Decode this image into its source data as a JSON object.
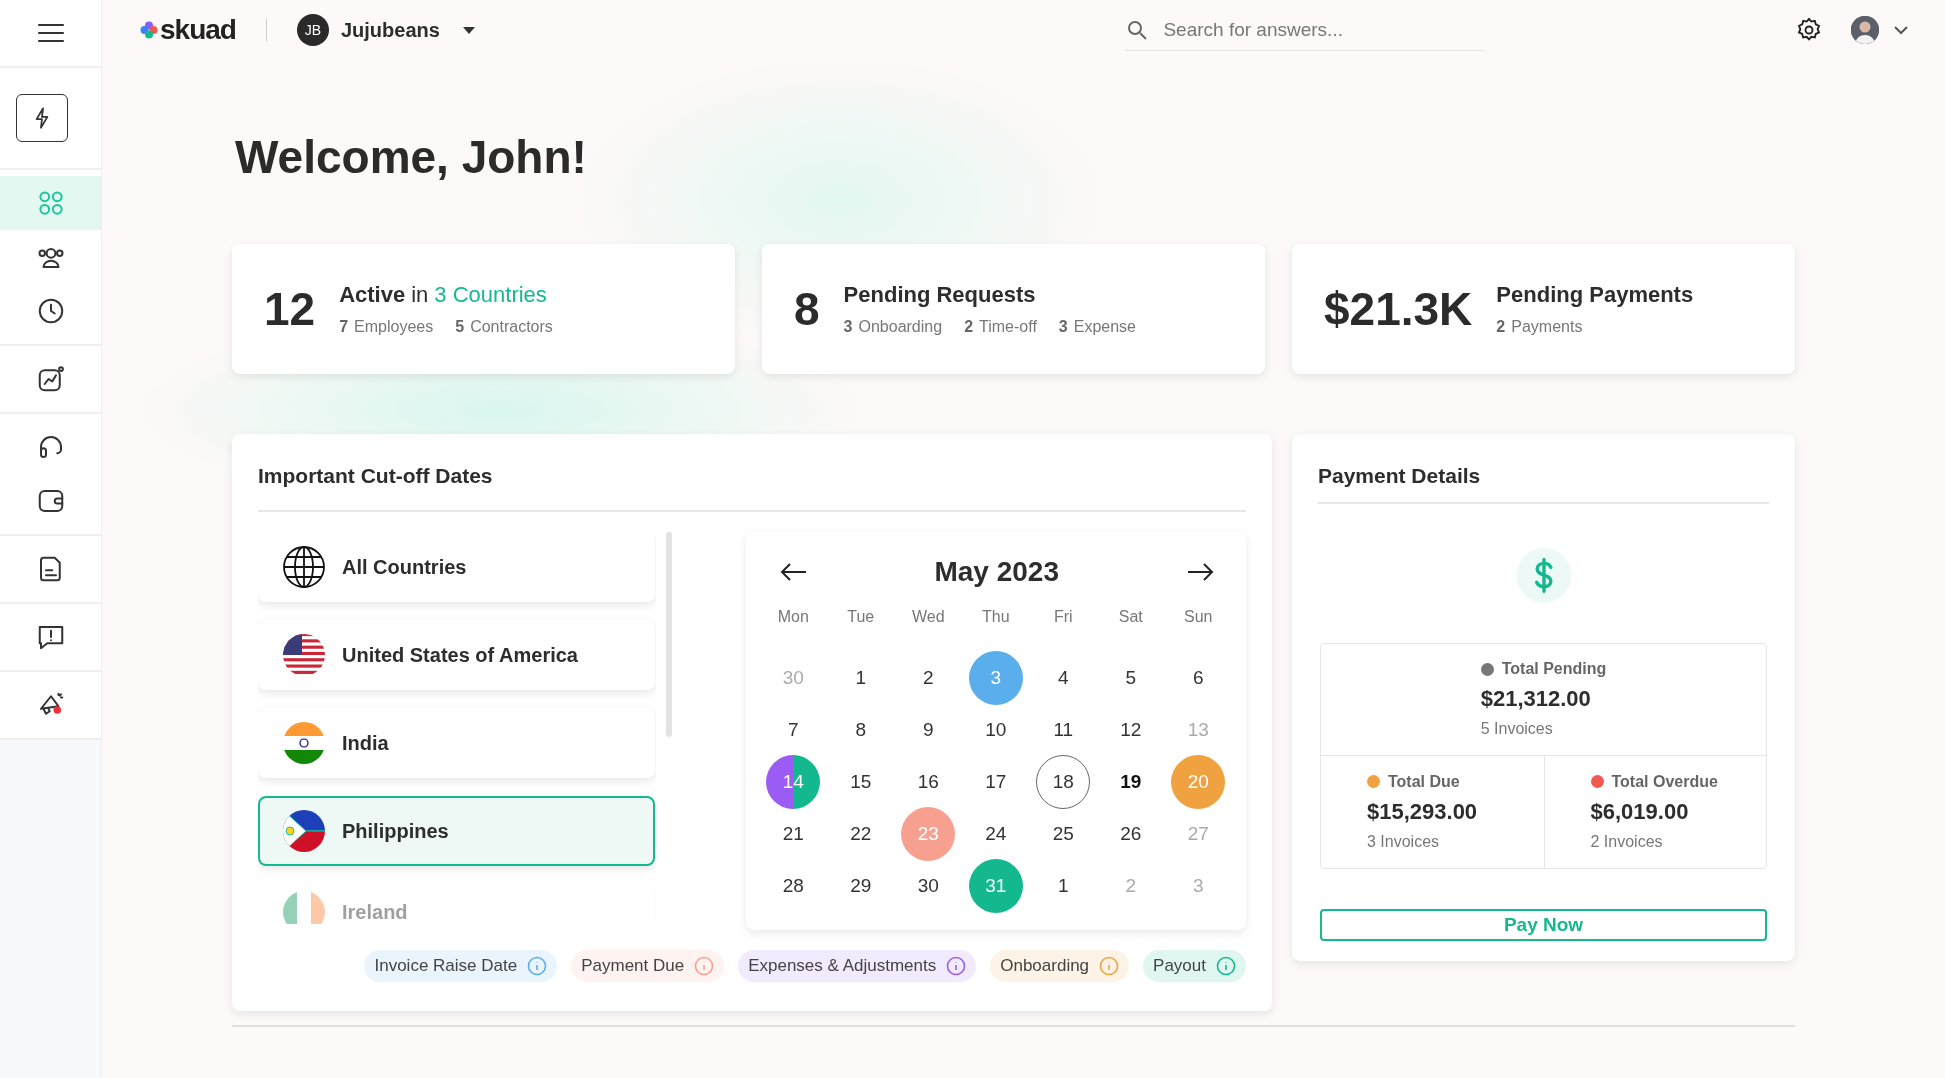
{
  "sidebar": {
    "groups": [
      [
        {
          "selected": false
        }
      ],
      [
        {
          "selected": false
        }
      ],
      [
        {
          "selected": true
        },
        {
          "selected": false
        },
        {
          "selected": false
        }
      ],
      [
        {
          "selected": false
        }
      ],
      [
        {
          "selected": false
        },
        {
          "selected": false
        }
      ],
      [
        {
          "selected": false
        }
      ],
      [
        {
          "selected": false
        }
      ],
      [
        {
          "selected": false
        }
      ]
    ]
  },
  "header": {
    "logo": "skuad",
    "company": {
      "initials": "JB",
      "name": "Jujubeans"
    },
    "search": {
      "placeholder": "Search for answers..."
    }
  },
  "welcome": "Welcome, John!",
  "stats": [
    {
      "value": "12",
      "title": "Active",
      "connector": "in",
      "link": "3 Countries",
      "details": [
        {
          "count": "7",
          "label": "Employees"
        },
        {
          "count": "5",
          "label": "Contractors"
        }
      ]
    },
    {
      "value": "8",
      "title": "Pending Requests",
      "details": [
        {
          "count": "3",
          "label": "Onboarding"
        },
        {
          "count": "2",
          "label": "Time-off"
        },
        {
          "count": "3",
          "label": "Expense"
        }
      ]
    },
    {
      "value": "$21.3K",
      "title": "Pending Payments",
      "details": [
        {
          "count": "2",
          "label": "Payments"
        }
      ]
    }
  ],
  "cutoff": {
    "title": "Important Cut-off Dates",
    "countries": [
      {
        "name": "All Countries",
        "selected": false
      },
      {
        "name": "United States of America",
        "selected": false
      },
      {
        "name": "India",
        "selected": false
      },
      {
        "name": "Philippines",
        "selected": true
      },
      {
        "name": "Ireland",
        "selected": false
      }
    ],
    "calendar": {
      "month": "May 2023",
      "weekdays": [
        "Mon",
        "Tue",
        "Wed",
        "Thu",
        "Fri",
        "Sat",
        "Sun"
      ],
      "days": [
        {
          "label": "30",
          "kind": "muted",
          "selected": false
        },
        {
          "label": "1",
          "kind": "plain",
          "selected": false
        },
        {
          "label": "2",
          "kind": "plain",
          "selected": false
        },
        {
          "label": "3",
          "kind": "plain",
          "selected": false,
          "markers": [
            {
              "color": "#5aaeec"
            }
          ]
        },
        {
          "label": "4",
          "kind": "plain",
          "selected": false
        },
        {
          "label": "5",
          "kind": "plain",
          "selected": false
        },
        {
          "label": "6",
          "kind": "plain",
          "selected": false
        },
        {
          "label": "7",
          "kind": "plain",
          "selected": false
        },
        {
          "label": "8",
          "kind": "plain",
          "selected": false
        },
        {
          "label": "9",
          "kind": "plain",
          "selected": false
        },
        {
          "label": "10",
          "kind": "plain",
          "selected": false
        },
        {
          "label": "11",
          "kind": "plain",
          "selected": false
        },
        {
          "label": "12",
          "kind": "plain",
          "selected": false
        },
        {
          "label": "13",
          "kind": "muted",
          "selected": false
        },
        {
          "label": "14",
          "kind": "plain",
          "selected": false,
          "markers": [
            {
              "color": "#9b5cf6"
            },
            {
              "color": "#14b88f"
            }
          ]
        },
        {
          "label": "15",
          "kind": "plain",
          "selected": false
        },
        {
          "label": "16",
          "kind": "plain",
          "selected": false
        },
        {
          "label": "17",
          "kind": "plain",
          "selected": false
        },
        {
          "label": "18",
          "kind": "plain",
          "selected": true
        },
        {
          "label": "19",
          "kind": "strong",
          "selected": false
        },
        {
          "label": "20",
          "kind": "plain",
          "selected": false,
          "markers": [
            {
              "color": "#f0a240"
            }
          ]
        },
        {
          "label": "21",
          "kind": "plain",
          "selected": false
        },
        {
          "label": "22",
          "kind": "plain",
          "selected": false
        },
        {
          "label": "23",
          "kind": "plain",
          "selected": false,
          "markers": [
            {
              "color": "#f7a090"
            }
          ]
        },
        {
          "label": "24",
          "kind": "plain",
          "selected": false
        },
        {
          "label": "25",
          "kind": "plain",
          "selected": false
        },
        {
          "label": "26",
          "kind": "plain",
          "selected": false
        },
        {
          "label": "27",
          "kind": "muted",
          "selected": false
        },
        {
          "label": "28",
          "kind": "plain",
          "selected": false
        },
        {
          "label": "29",
          "kind": "plain",
          "selected": false
        },
        {
          "label": "30",
          "kind": "plain",
          "selected": false
        },
        {
          "label": "31",
          "kind": "plain",
          "selected": false,
          "markers": [
            {
              "color": "#14b88f"
            }
          ]
        },
        {
          "label": "1",
          "kind": "plain",
          "selected": false
        },
        {
          "label": "2",
          "kind": "muted",
          "selected": false
        },
        {
          "label": "3",
          "kind": "muted",
          "selected": false
        }
      ]
    },
    "legend": [
      {
        "label": "Invoice Raise Date",
        "color": "#5aaeec"
      },
      {
        "label": "Payment Due",
        "color": "#f7a090"
      },
      {
        "label": "Expenses & Adjustments",
        "color": "#9b5cf6"
      },
      {
        "label": "Onboarding",
        "color": "#f0a240"
      },
      {
        "label": "Payout",
        "color": "#14b88f"
      }
    ]
  },
  "payment": {
    "title": "Payment Details",
    "totals": [
      {
        "label": "Total Pending",
        "amount": "$21,312.00",
        "invoices": "5 Invoices",
        "color": "#777777"
      },
      {
        "label": "Total Due",
        "amount": "$15,293.00",
        "invoices": "3 Invoices",
        "color": "#f0a240"
      },
      {
        "label": "Total Overdue",
        "amount": "$6,019.00",
        "invoices": "2 Invoices",
        "color": "#ee5a52"
      }
    ],
    "button": "Pay Now"
  }
}
